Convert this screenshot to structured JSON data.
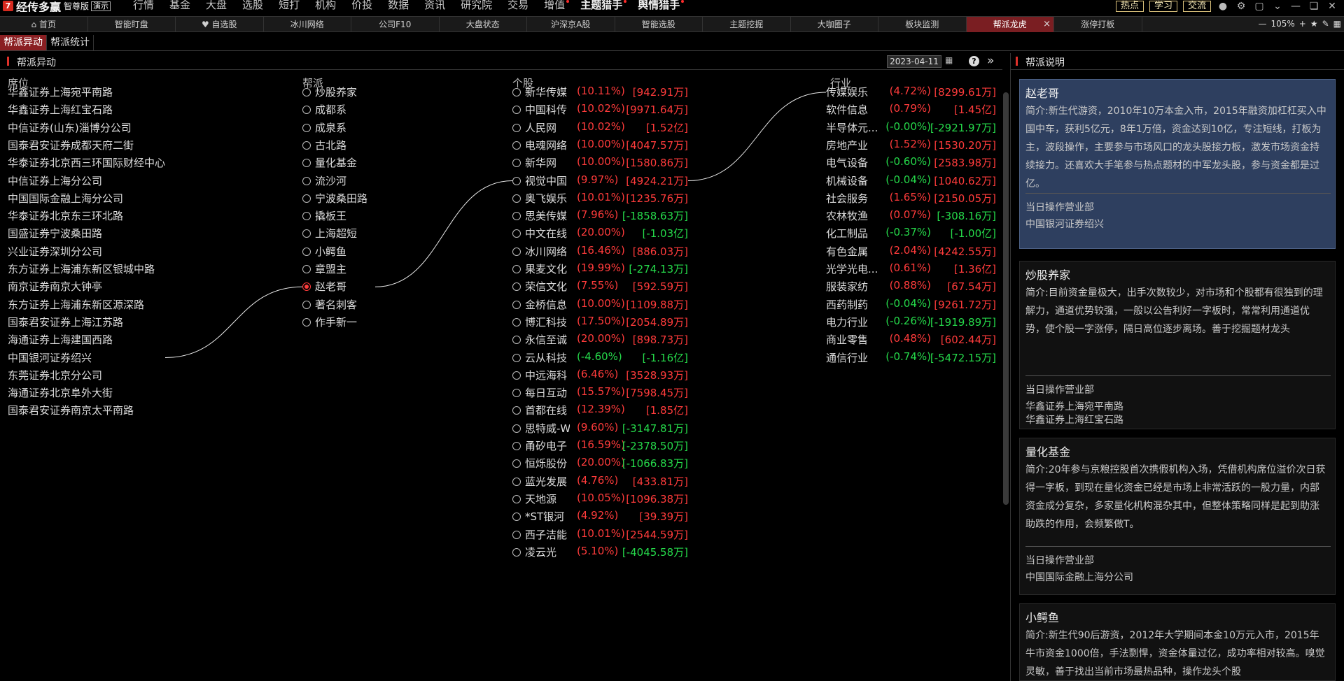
{
  "app": {
    "name": "经传多赢",
    "edition": "智尊版",
    "mode": "演示"
  },
  "menu": [
    "行情",
    "基金",
    "大盘",
    "选股",
    "短打",
    "机构",
    "价投",
    "数据",
    "资讯",
    "研究院",
    "交易",
    "增值",
    "主题猎手",
    "舆情猎手"
  ],
  "topright": {
    "buttons": [
      "热点",
      "学习",
      "交流"
    ],
    "icons": [
      "user-icon",
      "gear-icon",
      "window-icon",
      "minimize-icon",
      "restore-icon",
      "close-icon"
    ]
  },
  "tabs": [
    "首页",
    "智能盯盘",
    "自选股",
    "冰川网络",
    "公司F10",
    "大盘状态",
    "沪深京A股",
    "智能选股",
    "主题挖掘",
    "大咖圈子",
    "板块监测",
    "帮派龙虎",
    "涨停打板"
  ],
  "active_tab": "帮派龙虎",
  "zoom": "105%",
  "subtabs": [
    "帮派异动",
    "帮派统计"
  ],
  "panel": {
    "title": "帮派异动",
    "date": "2023-04-11"
  },
  "columns": {
    "seat": "席位",
    "pai": "帮派",
    "stock": "个股",
    "industry": "行业"
  },
  "seats": [
    "华鑫证券上海宛平南路",
    "华鑫证券上海红宝石路",
    "中信证券(山东)淄博分公司",
    "国泰君安证券成都天府二街",
    "华泰证券北京西三环国际财经中心",
    "中信证券上海分公司",
    "中国国际金融上海分公司",
    "华泰证券北京东三环北路",
    "国盛证券宁波桑田路",
    "兴业证券深圳分公司",
    "东方证券上海浦东新区银城中路",
    "南京证券南京大钟亭",
    "东方证券上海浦东新区源深路",
    "国泰君安证券上海江苏路",
    "海通证券上海建国西路",
    "中国银河证券绍兴",
    "东莞证券北京分公司",
    "海通证券北京阜外大街",
    "国泰君安证券南京太平南路"
  ],
  "pais": [
    "炒股养家",
    "成都系",
    "成泉系",
    "古北路",
    "量化基金",
    "流沙河",
    "宁波桑田路",
    "撬板王",
    "上海超短",
    "小鳄鱼",
    "章盟主",
    "赵老哥",
    "著名刺客",
    "作手新一"
  ],
  "selected_pai": "赵老哥",
  "stocks": [
    {
      "name": "新华传媒",
      "pct": "(10.11%)",
      "amt": "[942.91万]",
      "dir": "up"
    },
    {
      "name": "中国科传",
      "pct": "(10.02%)",
      "amt": "[9971.64万]",
      "dir": "up"
    },
    {
      "name": "人民网",
      "pct": "(10.02%)",
      "amt": "[1.52亿]",
      "dir": "up"
    },
    {
      "name": "电魂网络",
      "pct": "(10.00%)",
      "amt": "[4047.57万]",
      "dir": "up"
    },
    {
      "name": "新华网",
      "pct": "(10.00%)",
      "amt": "[1580.86万]",
      "dir": "up"
    },
    {
      "name": "视觉中国",
      "pct": "(9.97%)",
      "amt": "[4924.21万]",
      "dir": "up"
    },
    {
      "name": "奥飞娱乐",
      "pct": "(10.01%)",
      "amt": "[1235.76万]",
      "dir": "up"
    },
    {
      "name": "思美传媒",
      "pct": "(7.96%)",
      "amt": "[-1858.63万]",
      "dir": "mix"
    },
    {
      "name": "中文在线",
      "pct": "(20.00%)",
      "amt": "[-1.03亿]",
      "dir": "mix"
    },
    {
      "name": "冰川网络",
      "pct": "(16.46%)",
      "amt": "[886.03万]",
      "dir": "up"
    },
    {
      "name": "果麦文化",
      "pct": "(19.99%)",
      "amt": "[-274.13万]",
      "dir": "mix"
    },
    {
      "name": "荣信文化",
      "pct": "(7.55%)",
      "amt": "[592.59万]",
      "dir": "up"
    },
    {
      "name": "金桥信息",
      "pct": "(10.00%)",
      "amt": "[1109.88万]",
      "dir": "up"
    },
    {
      "name": "博汇科技",
      "pct": "(17.50%)",
      "amt": "[2054.89万]",
      "dir": "up"
    },
    {
      "name": "永信至诚",
      "pct": "(20.00%)",
      "amt": "[898.73万]",
      "dir": "up"
    },
    {
      "name": "云从科技",
      "pct": "(-4.60%)",
      "amt": "[-1.16亿]",
      "dir": "dn"
    },
    {
      "name": "中远海科",
      "pct": "(6.46%)",
      "amt": "[3528.93万]",
      "dir": "up"
    },
    {
      "name": "每日互动",
      "pct": "(15.57%)",
      "amt": "[7598.45万]",
      "dir": "up"
    },
    {
      "name": "首都在线",
      "pct": "(12.39%)",
      "amt": "[1.85亿]",
      "dir": "up"
    },
    {
      "name": "思特威-W",
      "pct": "(9.60%)",
      "amt": "[-3147.81万]",
      "dir": "mix"
    },
    {
      "name": "甬矽电子",
      "pct": "(16.59%)",
      "amt": "[-2378.50万]",
      "dir": "mix"
    },
    {
      "name": "恒烁股份",
      "pct": "(20.00%)",
      "amt": "[-1066.83万]",
      "dir": "mix"
    },
    {
      "name": "蓝光发展",
      "pct": "(4.76%)",
      "amt": "[433.81万]",
      "dir": "up"
    },
    {
      "name": "天地源",
      "pct": "(10.05%)",
      "amt": "[1096.38万]",
      "dir": "up"
    },
    {
      "name": "*ST银河",
      "pct": "(4.92%)",
      "amt": "[39.39万]",
      "dir": "up"
    },
    {
      "name": "西子洁能",
      "pct": "(10.01%)",
      "amt": "[2544.59万]",
      "dir": "up"
    },
    {
      "name": "凌云光",
      "pct": "(5.10%)",
      "amt": "[-4045.58万]",
      "dir": "mix"
    }
  ],
  "industries": [
    {
      "name": "传媒娱乐",
      "pct": "(4.72%)",
      "amt": "[8299.61万]",
      "dir": "up"
    },
    {
      "name": "软件信息",
      "pct": "(0.79%)",
      "amt": "[1.45亿]",
      "dir": "up"
    },
    {
      "name": "半导体元...",
      "pct": "(-0.00%)",
      "amt": "[-2921.97万]",
      "dir": "dn"
    },
    {
      "name": "房地产业",
      "pct": "(1.52%)",
      "amt": "[1530.20万]",
      "dir": "up"
    },
    {
      "name": "电气设备",
      "pct": "(-0.60%)",
      "amt": "[2583.98万]",
      "dir": "dnup"
    },
    {
      "name": "机械设备",
      "pct": "(-0.04%)",
      "amt": "[1040.62万]",
      "dir": "dnup"
    },
    {
      "name": "社会服务",
      "pct": "(1.65%)",
      "amt": "[2150.05万]",
      "dir": "up"
    },
    {
      "name": "农林牧渔",
      "pct": "(0.07%)",
      "amt": "[-308.16万]",
      "dir": "mix"
    },
    {
      "name": "化工制品",
      "pct": "(-0.37%)",
      "amt": "[-1.00亿]",
      "dir": "dn"
    },
    {
      "name": "有色金属",
      "pct": "(2.04%)",
      "amt": "[4242.55万]",
      "dir": "up"
    },
    {
      "name": "光学光电...",
      "pct": "(0.61%)",
      "amt": "[1.36亿]",
      "dir": "up"
    },
    {
      "name": "服装家纺",
      "pct": "(0.88%)",
      "amt": "[67.54万]",
      "dir": "up"
    },
    {
      "name": "西药制药",
      "pct": "(-0.04%)",
      "amt": "[9261.72万]",
      "dir": "dnup"
    },
    {
      "name": "电力行业",
      "pct": "(-0.26%)",
      "amt": "[-1919.89万]",
      "dir": "dn"
    },
    {
      "name": "商业零售",
      "pct": "(0.48%)",
      "amt": "[602.44万]",
      "dir": "up"
    },
    {
      "name": "通信行业",
      "pct": "(-0.74%)",
      "amt": "[-5472.15万]",
      "dir": "dn"
    }
  ],
  "links": {
    "seat": "中国银河证券绍兴",
    "pai": "赵老哥",
    "stock": "视觉中国",
    "industry": "传媒娱乐"
  },
  "right": {
    "title": "帮派说明",
    "cards": [
      {
        "name": "赵老哥",
        "desc": "简介:新生代游资，2010年10万本金入市，2015年融资加杠杠买入中国中车，获利5亿元，8年1万倍，资金达到10亿，专注短线，打板为主，波段操作，主要参与市场风口的龙头股接力板，激发市场资金持续接力。还喜欢大手笔参与热点题材的中军龙头股，参与资金都是过亿。",
        "ops_label": "当日操作营业部",
        "ops": [
          "中国银河证券绍兴"
        ]
      },
      {
        "name": "炒股养家",
        "desc": "简介:目前资金量极大，出手次数较少，对市场和个股都有很独到的理解力，通道优势较强，一般以公告利好一字板时，常常利用通道优势，使个股一字涨停，隔日高位逐步离场。善于挖掘题材龙头",
        "ops_label": "当日操作营业部",
        "ops": [
          "华鑫证券上海宛平南路",
          "华鑫证券上海红宝石路"
        ]
      },
      {
        "name": "量化基金",
        "desc": "简介:20年参与京粮控股首次携假机构入场，凭借机构席位溢价次日获得一字板，到现在量化资金已经是市场上非常活跃的一股力量，内部资金成分复杂，多家量化机构混杂其中，但整体策略同样是起到助涨助跌的作用，会频繁做T。",
        "ops_label": "当日操作营业部",
        "ops": [
          "中国国际金融上海分公司"
        ]
      },
      {
        "name": "小鳄鱼",
        "desc": "简介:新生代90后游资，2012年大学期间本金10万元入市，2015年牛市资金1000倍，手法剽悍，资金体量过亿，成功率相对较高。嗅觉灵敏，善于找出当前市场最热品种，操作龙头个股",
        "ops_label": "",
        "ops": []
      }
    ]
  },
  "colors": {
    "up": "#ff3b3b",
    "down": "#25d94a",
    "accent": "#7a1e22",
    "selected_card": "#2e3f5f"
  }
}
